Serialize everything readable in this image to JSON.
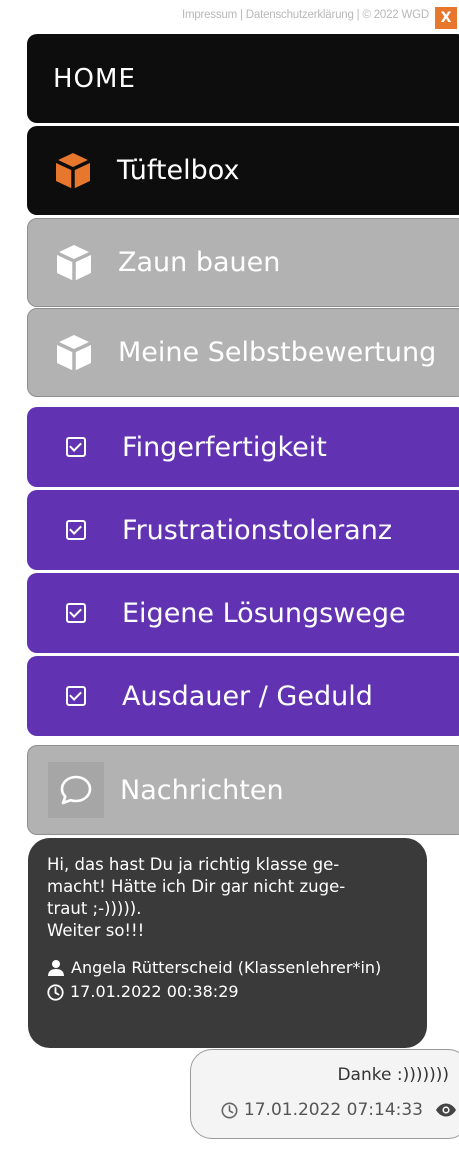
{
  "footer": {
    "links": "Impressum | Datenschutzerklärung | © 2022 WGD",
    "close_label": "X"
  },
  "menu": {
    "home": "HOME",
    "tuftelbox": "Tüftelbox",
    "zaun": "Zaun bauen",
    "selbstbewertung": "Meine Selbstbewertung",
    "skills": [
      "Fingerfertigkeit",
      "Frustrationstoleranz",
      "Eigene Lösungswege",
      "Ausdauer / Geduld"
    ],
    "nachrichten": "Nachrichten"
  },
  "messages": {
    "incoming": {
      "text": "Hi, das hast Du ja richtig klasse ge-\nmacht! Hätte ich Dir gar nicht zuge-\ntraut ;-))))).\nWeiter so!!!",
      "author": "Angela Rütterscheid (Klassenlehrer*in)",
      "timestamp": "17.01.2022 00:38:29"
    },
    "outgoing": {
      "text": "Danke :)))))))",
      "timestamp": "17.01.2022 07:14:33"
    }
  },
  "colors": {
    "dark": "#0d0d0d",
    "grey": "#b2b2b2",
    "purple": "#6132b2",
    "orange": "#e8772e"
  },
  "icons": {
    "cube_active": "cube-icon-orange",
    "cube_inactive": "cube-icon-white",
    "check": "checkbox-icon",
    "chat": "chat-bubble-icon",
    "user": "user-icon",
    "clock": "clock-icon",
    "eye": "eye-icon"
  }
}
